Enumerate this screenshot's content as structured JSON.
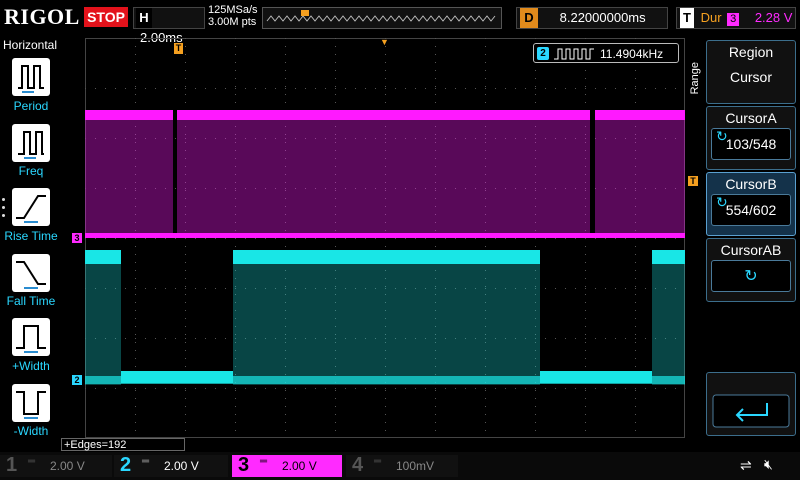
{
  "header": {
    "brand": "RIGOL",
    "run_state": "STOP",
    "timebase_label": "H",
    "timebase_value": "2.00ms",
    "sample_rate": "125MSa/s",
    "memory_depth": "3.00M pts",
    "delay_label": "D",
    "delay_value": "8.22000000ms",
    "trigger_label": "T",
    "trigger_mode": "Dur",
    "trigger_source": "3",
    "trigger_level": "2.28 V"
  },
  "left_panel": {
    "title": "Horizontal",
    "items": [
      {
        "label": "Period",
        "icon": "period-icon"
      },
      {
        "label": "Freq",
        "icon": "freq-icon"
      },
      {
        "label": "Rise Time",
        "icon": "rise-time-icon"
      },
      {
        "label": "Fall Time",
        "icon": "fall-time-icon"
      },
      {
        "label": "+Width",
        "icon": "pos-width-icon"
      },
      {
        "label": "-Width",
        "icon": "neg-width-icon"
      }
    ]
  },
  "right_panel": {
    "range_label": "Range",
    "region": {
      "head": "Region",
      "value": "Cursor"
    },
    "cursor_a": {
      "head": "CursorA",
      "value": "103/548"
    },
    "cursor_b": {
      "head": "CursorB",
      "value": "554/602"
    },
    "cursor_ab": {
      "head": "CursorAB",
      "value": ""
    }
  },
  "plot": {
    "freq_channel": "2",
    "freq_value": "11.4904kHz",
    "edges_label": "+Edges=192",
    "ch3_marker": "3",
    "ch2_marker": "2",
    "trigger_marker": "T"
  },
  "channels": [
    {
      "num": "1",
      "value": "2.00 V",
      "color": "#c8c020"
    },
    {
      "num": "2",
      "value": "2.00 V",
      "color": "#2ad7ff"
    },
    {
      "num": "3",
      "value": "2.00 V",
      "color": "#ff2aff"
    },
    {
      "num": "4",
      "value": "100mV",
      "color": "#3b6fd9"
    }
  ],
  "colors": {
    "ch2": "#19e6e6",
    "ch3": "#ff19ff",
    "accent": "#f5a020"
  }
}
